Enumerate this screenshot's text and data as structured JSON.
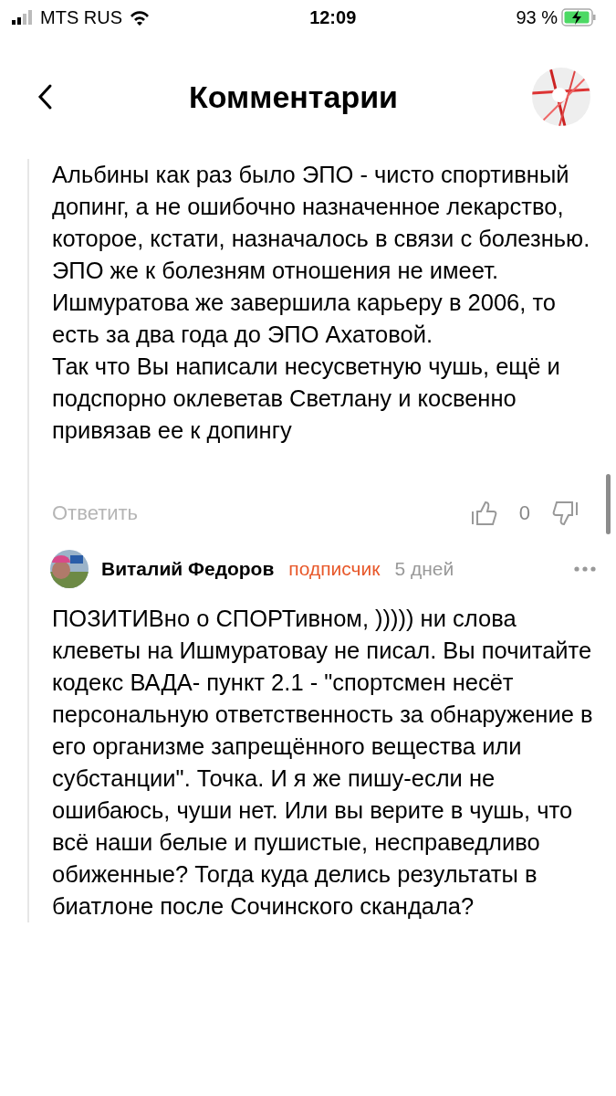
{
  "status_bar": {
    "carrier": "MTS RUS",
    "time": "12:09",
    "battery": "93 %"
  },
  "header": {
    "title": "Комментарии"
  },
  "comments": [
    {
      "paragraphs": [
        "Альбины как раз было ЭПО - чисто спортивный допинг, а не ошибочно назначенное лекарство, которое, кстати, назначалось в связи с болезнью. ЭПО же к болезням отношения не имеет. Ишмуратова же завершила карьеру в 2006, то есть за два года до ЭПО Ахатовой.",
        "Так что Вы написали несусветную чушь, ещё и подспорно оклеветав Светлану и косвенно привязав ее к допингу"
      ],
      "reply": "Ответить",
      "score": "0"
    },
    {
      "author": "Виталий Федоров",
      "badge": "подписчик",
      "time": "5 дней",
      "paragraphs": [
        "ПОЗИТИВно о СПОРТивном, ))))) ни слова клеветы на Ишмуратовау не писал. Вы почитайте кодекс ВАДА- пункт 2.1 - \"спортсмен несёт персональную ответственность за обнаружение в его организме запрещённого вещества или субстанции\". Точка. И я же пишу-если не ошибаюсь, чуши нет. Или вы верите в чушь, что всё наши белые и пушистые, несправедливо обиженные? Тогда куда делись результаты в биатлоне после Сочинского скандала?"
      ]
    }
  ]
}
